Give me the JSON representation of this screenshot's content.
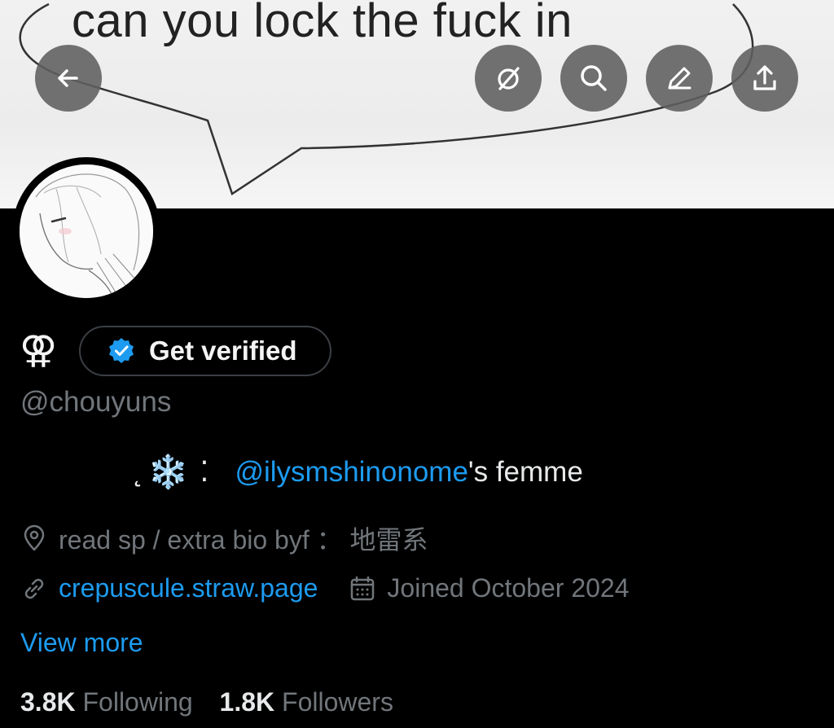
{
  "banner": {
    "caption": "can you lock the fuck in"
  },
  "header": {
    "back_icon": "arrow-left-icon",
    "actions": [
      {
        "name": "grok-icon"
      },
      {
        "name": "search-icon"
      },
      {
        "name": "edit-icon"
      },
      {
        "name": "share-icon"
      }
    ]
  },
  "profile": {
    "name_symbol": "⚢",
    "verify_label": "Get verified",
    "handle": "@chouyuns",
    "bio": {
      "prefix": "˛",
      "emoji": "❄️",
      "separator": "⁚",
      "mention": "@ilysmshinonome",
      "suffix": "'s femme"
    },
    "location": "read sp / extra bio byf ： 地雷系",
    "website": "crepuscule.straw.page",
    "joined": "Joined October 2024",
    "view_more": "View more",
    "following_count": "3.8K",
    "following_label": "Following",
    "followers_count": "1.8K",
    "followers_label": "Followers"
  },
  "colors": {
    "accent": "#1d9bf0",
    "muted": "#71767b",
    "background": "#000000"
  }
}
